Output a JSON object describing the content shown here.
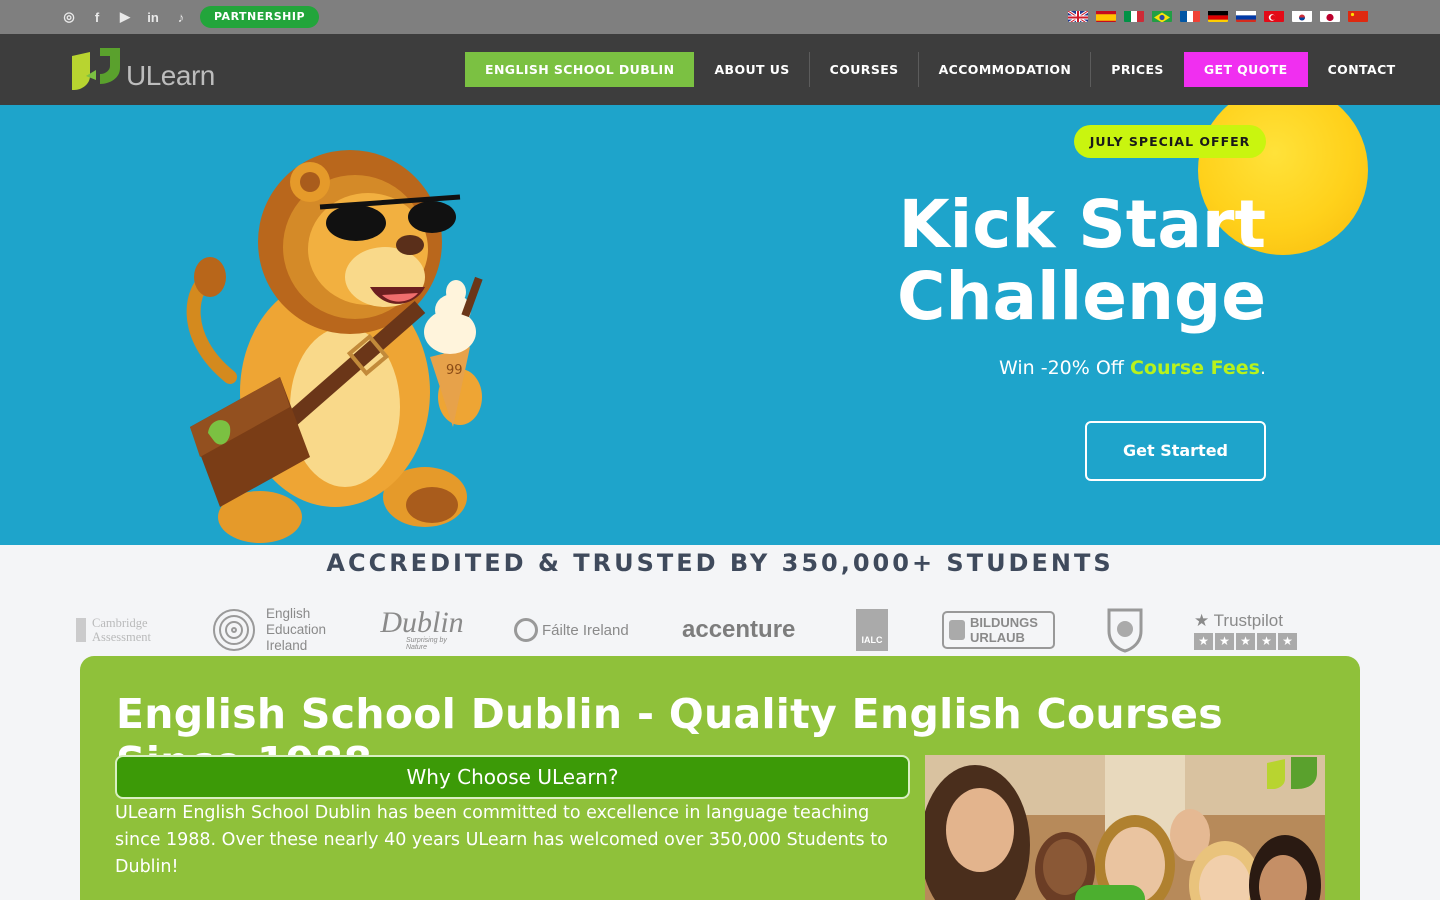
{
  "topbar": {
    "social": [
      {
        "icon": "instagram-icon",
        "glyph": "◎"
      },
      {
        "icon": "facebook-icon",
        "glyph": "f"
      },
      {
        "icon": "youtube-icon",
        "glyph": "▶"
      },
      {
        "icon": "linkedin-icon",
        "glyph": "in"
      },
      {
        "icon": "tiktok-icon",
        "glyph": "♪"
      }
    ],
    "partnership_label": "PARTNERSHIP",
    "languages": [
      "flag-uk-icon",
      "flag-spain-icon",
      "flag-italy-icon",
      "flag-brazil-icon",
      "flag-france-icon",
      "flag-germany-icon",
      "flag-russia-icon",
      "flag-turkey-icon",
      "flag-korea-icon",
      "flag-japan-icon",
      "flag-china-icon"
    ]
  },
  "nav": {
    "logo_text": "ULearn",
    "items": [
      {
        "label": "ENGLISH SCHOOL DUBLIN",
        "style": "green"
      },
      {
        "label": "ABOUT US",
        "style": "plain"
      },
      {
        "label": "COURSES",
        "style": "plain"
      },
      {
        "label": "ACCOMMODATION",
        "style": "plain"
      },
      {
        "label": "PRICES",
        "style": "plain"
      },
      {
        "label": "GET QUOTE",
        "style": "pink"
      },
      {
        "label": "CONTACT",
        "style": "plain"
      }
    ]
  },
  "hero": {
    "badge": "JULY SPECIAL OFFER",
    "title_line1": "Kick Start",
    "title_line2": "Challenge",
    "subtitle_pre": "Win -20% Off ",
    "subtitle_highlight": "Course Fees",
    "subtitle_post": ".",
    "cta_label": "Get Started",
    "mascot_cone_text": "99"
  },
  "accreditation": {
    "title": "ACCREDITED & TRUSTED BY 350,000+ STUDENTS",
    "logos": {
      "cambridge_line1": "Cambridge",
      "cambridge_line2": "Assessment",
      "eei_line1": "English",
      "eei_line2": "Education",
      "eei_line3": "Ireland",
      "dublin": "Dublin",
      "dublin_tag": "Surprising by Nature",
      "failte": "Fáilte Ireland",
      "accenture": "accenture",
      "ialc": "IALC",
      "bildung_line1": "BILDUNGS",
      "bildung_line2": "URLAUB",
      "trustpilot": "Trustpilot"
    }
  },
  "about": {
    "heading": "English School Dublin - Quality English Courses Since 1988",
    "why_label": "Why Choose ULearn?",
    "body": "ULearn English School Dublin has been committed to excellence in language teaching since 1988. Over these nearly 40 years ULearn has welcomed over 350,000 Students to Dublin!"
  },
  "colors": {
    "topbar": "#7f7f7f",
    "nav": "#3d3d3d",
    "brand_green": "#7bc142",
    "get_quote_pink": "#f02ff0",
    "hero_blue": "#1ea4cb",
    "offer_lime": "#c9f50f",
    "card_green": "#8fc13a"
  }
}
